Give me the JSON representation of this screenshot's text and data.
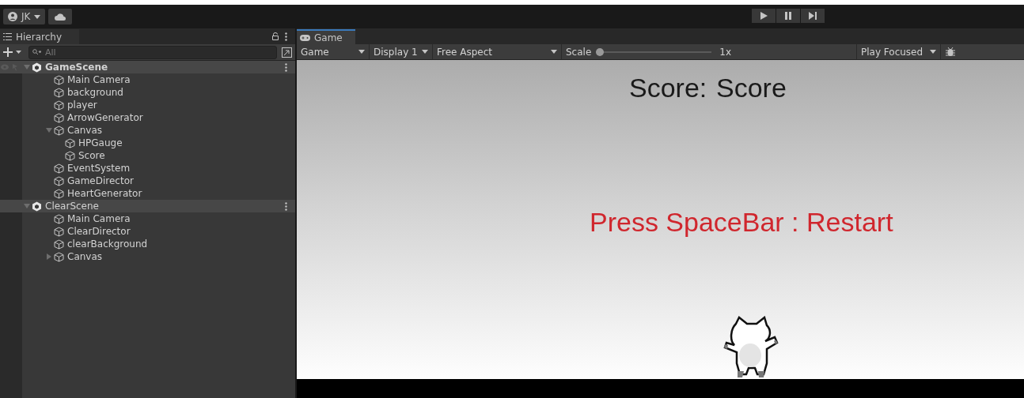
{
  "toolbar": {
    "account": "JK"
  },
  "hierarchy": {
    "title": "Hierarchy",
    "search": {
      "placeholder": "All"
    },
    "scenes": [
      {
        "name": "GameScene",
        "expanded": true,
        "children": [
          {
            "name": "Main Camera"
          },
          {
            "name": "background"
          },
          {
            "name": "player"
          },
          {
            "name": "ArrowGenerator"
          },
          {
            "name": "Canvas",
            "expanded": true,
            "children": [
              {
                "name": "HPGauge"
              },
              {
                "name": "Score"
              }
            ]
          },
          {
            "name": "EventSystem"
          },
          {
            "name": "GameDirector"
          },
          {
            "name": "HeartGenerator"
          }
        ]
      },
      {
        "name": "ClearScene",
        "expanded": true,
        "children": [
          {
            "name": "Main Camera"
          },
          {
            "name": "ClearDirector"
          },
          {
            "name": "clearBackground"
          },
          {
            "name": "Canvas",
            "expanded": false
          }
        ]
      }
    ]
  },
  "game": {
    "tab": "Game",
    "display_mode": "Game",
    "display": "Display 1",
    "aspect": "Free Aspect",
    "scale": {
      "label": "Scale",
      "level": 0,
      "reading": "1x"
    },
    "play_mode": "Play Focused",
    "texts": [
      {
        "kind": "score",
        "text": "Score:"
      },
      {
        "kind": "score_overlap",
        "text": "Score"
      },
      {
        "kind": "message",
        "text": "Press SpaceBar : Restart"
      }
    ]
  }
}
